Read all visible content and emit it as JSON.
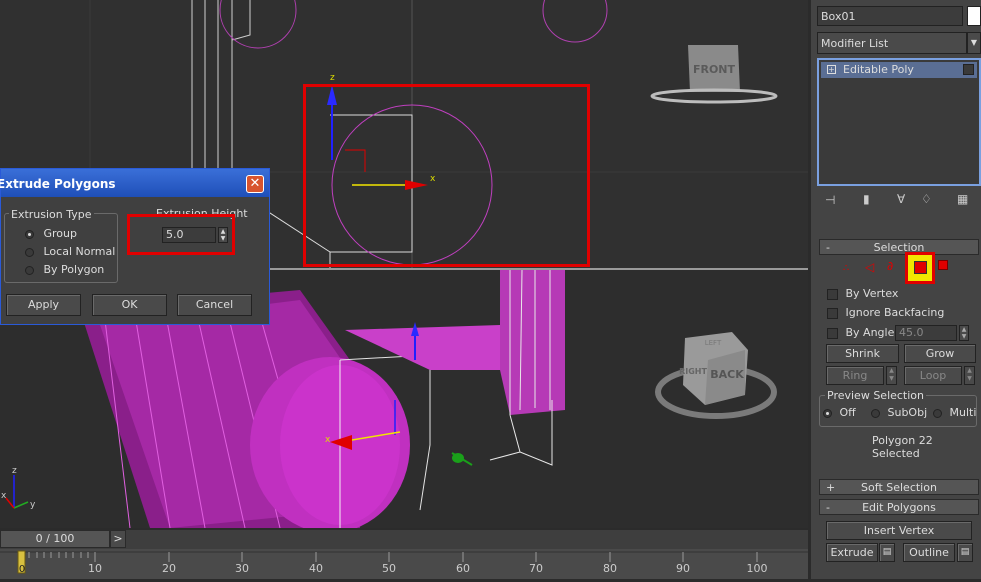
{
  "viewport_top": {
    "navcube_label": "FRONT"
  },
  "viewport_persp": {
    "navcube_top": "LEFT",
    "navcube_front": "BACK",
    "navcube_side": "RIGHT"
  },
  "axes": {
    "x": "x",
    "y": "y",
    "z": "z"
  },
  "dialog": {
    "title": "Extrude Polygons",
    "close_glyph": "✕",
    "extrusion_type_label": "Extrusion Type",
    "options": [
      "Group",
      "Local Normal",
      "By Polygon"
    ],
    "selected_option": "Group",
    "height_label": "Extrusion Height",
    "height_value": "5.0",
    "apply_label": "Apply",
    "ok_label": "OK",
    "cancel_label": "Cancel"
  },
  "command_panel": {
    "object_name": "Box01",
    "modifier_list": "Modifier List",
    "stack_item": "Editable Poly",
    "stack_item_icon": "plus-icon",
    "selection": {
      "header": "Selection",
      "by_vertex": "By Vertex",
      "ignore_backfacing": "Ignore Backfacing",
      "by_angle": "By Angle:",
      "angle_value": "45.0",
      "shrink": "Shrink",
      "grow": "Grow",
      "ring": "Ring",
      "loop": "Loop",
      "preview_label": "Preview Selection",
      "preview_options": [
        "Off",
        "SubObj",
        "Multi"
      ],
      "status": "Polygon 22 Selected"
    },
    "soft_selection_header": "Soft Selection",
    "edit_polygons_header": "Edit Polygons",
    "insert_vertex": "Insert Vertex",
    "extrude": "Extrude",
    "outline": "Outline",
    "colors": {
      "accent_red": "#e00000",
      "selected_yellow": "#f2e600",
      "mesh_magenta": "#cc33cc"
    }
  },
  "timeline": {
    "frame_counter": "0 / 100",
    "next_glyph": ">",
    "ticks": [
      "0",
      "10",
      "20",
      "30",
      "40",
      "50",
      "60",
      "70",
      "80",
      "90",
      "100"
    ]
  }
}
